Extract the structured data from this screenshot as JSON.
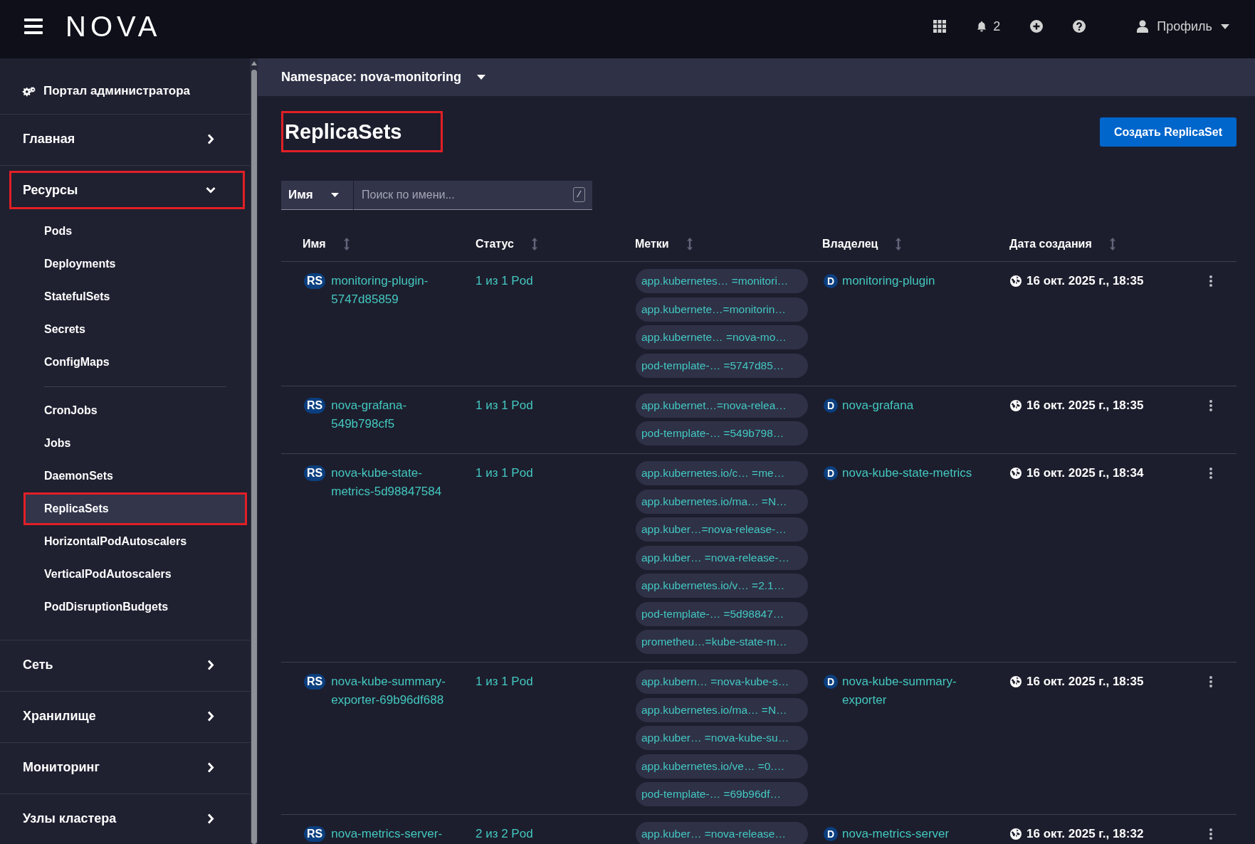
{
  "header": {
    "logo": "NOVA",
    "notification_count": "2",
    "profile_label": "Профиль"
  },
  "sidebar": {
    "portal_link": "Портал администратора",
    "items": [
      {
        "label": "Главная",
        "expanded": false,
        "highlighted": false
      },
      {
        "label": "Ресурсы",
        "expanded": true,
        "highlighted": true,
        "children": [
          {
            "kind": "link",
            "label": "Pods",
            "selected": false,
            "highlighted": false
          },
          {
            "kind": "link",
            "label": "Deployments",
            "selected": false,
            "highlighted": false
          },
          {
            "kind": "link",
            "label": "StatefulSets",
            "selected": false,
            "highlighted": false
          },
          {
            "kind": "link",
            "label": "Secrets",
            "selected": false,
            "highlighted": false
          },
          {
            "kind": "link",
            "label": "ConfigMaps",
            "selected": false,
            "highlighted": false
          },
          {
            "kind": "separator"
          },
          {
            "kind": "link",
            "label": "CronJobs",
            "selected": false,
            "highlighted": false
          },
          {
            "kind": "link",
            "label": "Jobs",
            "selected": false,
            "highlighted": false
          },
          {
            "kind": "link",
            "label": "DaemonSets",
            "selected": false,
            "highlighted": false
          },
          {
            "kind": "link",
            "label": "ReplicaSets",
            "selected": true,
            "highlighted": true
          },
          {
            "kind": "link",
            "label": "HorizontalPodAutoscalers",
            "selected": false,
            "highlighted": false
          },
          {
            "kind": "link",
            "label": "VerticalPodAutoscalers",
            "selected": false,
            "highlighted": false
          },
          {
            "kind": "link",
            "label": "PodDisruptionBudgets",
            "selected": false,
            "highlighted": false
          }
        ]
      },
      {
        "label": "Сеть",
        "expanded": false,
        "highlighted": false
      },
      {
        "label": "Хранилище",
        "expanded": false,
        "highlighted": false
      },
      {
        "label": "Мониторинг",
        "expanded": false,
        "highlighted": false
      },
      {
        "label": "Узлы кластера",
        "expanded": false,
        "highlighted": false
      }
    ]
  },
  "namespace_bar": {
    "label": "Namespace: nova-monitoring"
  },
  "page": {
    "title": "ReplicaSets",
    "title_highlighted": true,
    "create_button": "Создать ReplicaSet"
  },
  "filter": {
    "field": "Имя",
    "placeholder": "Поиск по имени...",
    "shortcut": "/"
  },
  "table": {
    "columns": [
      {
        "label": "Имя",
        "sortable": true
      },
      {
        "label": "Статус",
        "sortable": true
      },
      {
        "label": "Метки",
        "sortable": true
      },
      {
        "label": "Владелец",
        "sortable": true
      },
      {
        "label": "Дата создания",
        "sortable": true
      }
    ],
    "rows": [
      {
        "type_badge": "RS",
        "name": "monitoring-plugin-5747d85859",
        "status": "1 из 1 Pod",
        "labels": [
          "app.kubernetes… =monitori…",
          "app.kubernete…=monitorin…",
          "app.kubernete… =nova-mo…",
          "pod-template-… =5747d85…"
        ],
        "owner_badge": "D",
        "owner": "monitoring-plugin",
        "created": "16 окт. 2025 г., 18:35"
      },
      {
        "type_badge": "RS",
        "name": "nova-grafana-549b798cf5",
        "status": "1 из 1 Pod",
        "labels": [
          "app.kubernet…=nova-relea…",
          "pod-template-… =549b798…"
        ],
        "owner_badge": "D",
        "owner": "nova-grafana",
        "created": "16 окт. 2025 г., 18:35"
      },
      {
        "type_badge": "RS",
        "name": "nova-kube-state-metrics-5d98847584",
        "status": "1 из 1 Pod",
        "labels": [
          "app.kubernetes.io/c… =me…",
          "app.kubernetes.io/ma… =N…",
          "app.kuber…=nova-release-…",
          "app.kuber… =nova-release-…",
          "app.kubernetes.io/v… =2.1…",
          "pod-template-… =5d98847…",
          "prometheu…=kube-state-m…"
        ],
        "owner_badge": "D",
        "owner": "nova-kube-state-metrics",
        "created": "16 окт. 2025 г., 18:34"
      },
      {
        "type_badge": "RS",
        "name": "nova-kube-summary-exporter-69b96df688",
        "status": "1 из 1 Pod",
        "labels": [
          "app.kubern… =nova-kube-s…",
          "app.kubernetes.io/ma… =N…",
          "app.kuber… =nova-kube-su…",
          "app.kubernetes.io/ve… =0.…",
          "pod-template-… =69b96df…"
        ],
        "owner_badge": "D",
        "owner": "nova-kube-summary-exporter",
        "created": "16 окт. 2025 г., 18:35"
      },
      {
        "type_badge": "RS",
        "name": "nova-metrics-server-",
        "status": "2 из 2 Pod",
        "labels": [
          "app.kuber… =nova-release…"
        ],
        "owner_badge": "D",
        "owner": "nova-metrics-server",
        "created": "16 окт. 2025 г., 18:32"
      }
    ]
  }
}
